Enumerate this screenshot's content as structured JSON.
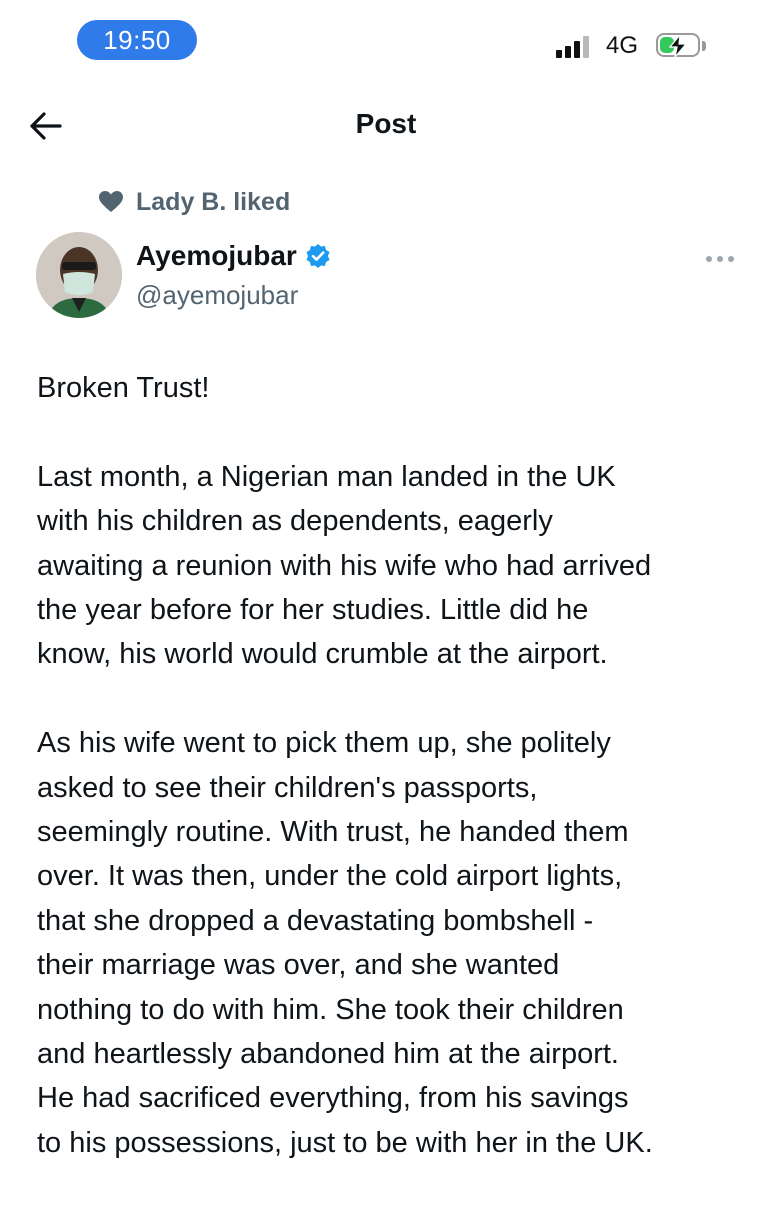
{
  "status_bar": {
    "time": "19:50",
    "network": "4G",
    "signal_bars": 4,
    "signal_bars_filled": 3,
    "battery_level": 0.4,
    "battery_color": "#34c759",
    "time_pill_color": "#2f7be9"
  },
  "header": {
    "title": "Post",
    "back_icon": "arrow-left-icon"
  },
  "social_context": {
    "icon": "heart-icon",
    "text": "Lady B. liked"
  },
  "author": {
    "name": "Ayemojubar",
    "verified": true,
    "verified_color": "#1d9bf0",
    "handle": "@ayemojubar",
    "more_icon": "more-horizontal-icon"
  },
  "post": {
    "paragraphs": [
      "Broken Trust!",
      "Last month, a Nigerian man landed in the UK\nwith his children as dependents, eagerly\nawaiting a reunion with his wife who had arrived\nthe year before for her studies. Little did he\nknow, his world would crumble at the airport.",
      "As his wife went to pick them up, she politely\nasked to see their children's passports,\nseemingly routine. With trust, he handed them\nover. It was then, under the cold airport lights,\nthat she dropped a devastating bombshell -\ntheir marriage was over, and she wanted\nnothing to do with him. She took their children\nand heartlessly abandoned him at the airport.\nHe had sacrificed everything, from his savings\nto his possessions, just to be with her in the UK."
    ]
  }
}
